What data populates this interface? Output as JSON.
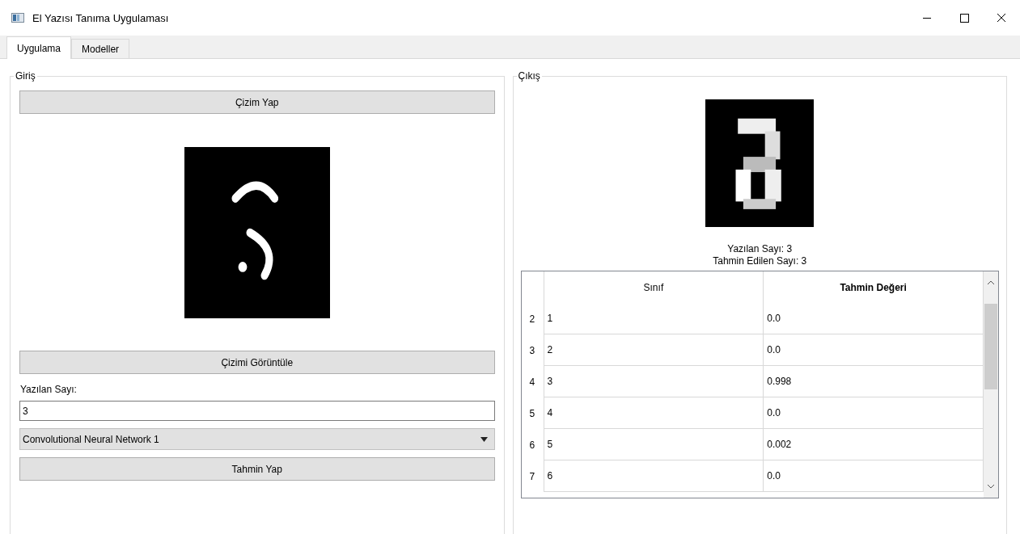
{
  "window": {
    "title": "El Yazısı Tanıma Uygulaması"
  },
  "tabs": [
    {
      "label": "Uygulama",
      "selected": true
    },
    {
      "label": "Modeller",
      "selected": false
    }
  ],
  "input_panel": {
    "title": "Giriş",
    "draw_button": "Çizim Yap",
    "view_button": "Çizimi Görüntüle",
    "number_label": "Yazılan Sayı:",
    "number_value": "3",
    "model_select": "Convolutional Neural Network 1",
    "predict_button": "Tahmin Yap"
  },
  "output_panel": {
    "title": "Çıkış",
    "written_text": "Yazılan Sayı: 3",
    "predicted_text": "Tahmin Edilen Sayı: 3",
    "table": {
      "columns": [
        {
          "label": "Sınıf",
          "bold": false
        },
        {
          "label": "Tahmin Değeri",
          "bold": true
        }
      ],
      "rows": [
        {
          "header": "2",
          "cells": [
            "1",
            "0.0"
          ]
        },
        {
          "header": "3",
          "cells": [
            "2",
            "0.0"
          ]
        },
        {
          "header": "4",
          "cells": [
            "3",
            "0.998"
          ]
        },
        {
          "header": "5",
          "cells": [
            "4",
            "0.0"
          ]
        },
        {
          "header": "6",
          "cells": [
            "5",
            "0.002"
          ]
        },
        {
          "header": "7",
          "cells": [
            "6",
            "0.0"
          ]
        }
      ]
    }
  }
}
